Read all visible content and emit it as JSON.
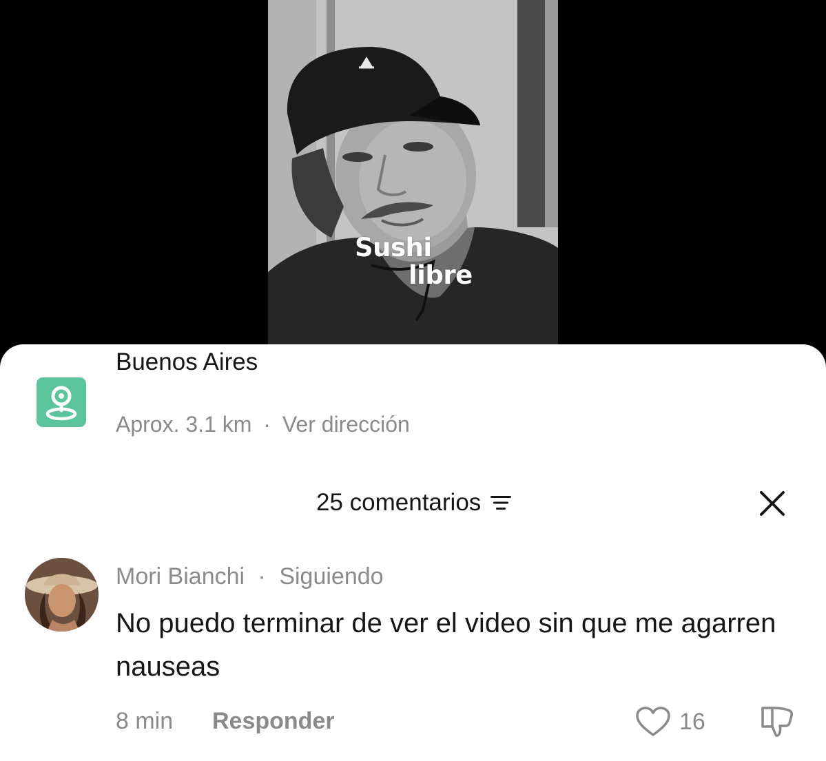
{
  "video": {
    "caption_line1": "Sushi",
    "caption_line2": "libre"
  },
  "location": {
    "icon": "location-pin-icon",
    "title": "Buenos Aires",
    "distance": "Aprox. 3.1 km",
    "separator": "·",
    "directions_link": "Ver dirección",
    "icon_color": "#5cc49d"
  },
  "comments": {
    "count_label": "25 comentarios",
    "sort_icon": "sort-lines-icon",
    "close_icon": "close-icon",
    "items": [
      {
        "author": "Mori Bianchi",
        "separator": "·",
        "relationship": "Siguiendo",
        "text": "No puedo terminar de ver el video sin que me agarren nauseas",
        "time": "8 min",
        "reply_label": "Responder",
        "likes": "16",
        "like_icon": "heart-outline-icon",
        "dislike_icon": "thumbs-down-icon"
      }
    ]
  },
  "colors": {
    "text_primary": "#161616",
    "text_secondary": "#8a8a8a",
    "sheet_bg": "#ffffff",
    "backdrop": "#000000"
  }
}
